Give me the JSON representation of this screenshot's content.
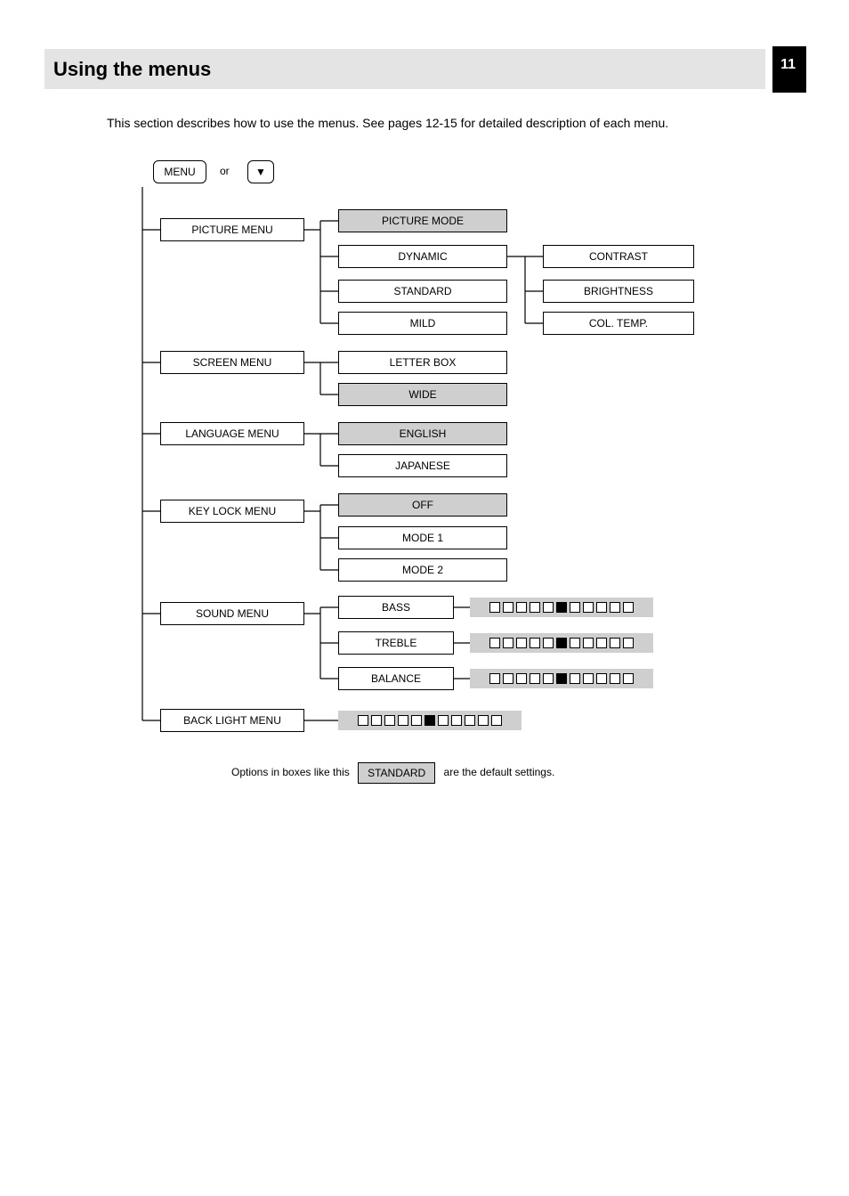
{
  "page_number": "11",
  "title": "Using the menus",
  "intro": "This section describes how to use the menus. See pages 12-15 for detailed description of each menu.",
  "root_button": "MENU",
  "arrow_button": "▼",
  "menu_items": {
    "picture": {
      "label": "PICTURE MENU",
      "options": {
        "picture_mode": "PICTURE MODE",
        "dynamic": "DYNAMIC",
        "standard": "STANDARD",
        "mild": "MILD",
        "contrast": "CONTRAST",
        "brightness": "BRIGHTNESS",
        "col_temp": "COL. TEMP."
      }
    },
    "screen": {
      "label": "SCREEN MENU",
      "options": {
        "letter_box": "LETTER BOX",
        "wide": "WIDE"
      }
    },
    "language": {
      "label": "LANGUAGE MENU",
      "options": {
        "english": "ENGLISH",
        "japanese": "JAPANESE"
      }
    },
    "key_lock": {
      "label": "KEY LOCK MENU",
      "options": {
        "off": "OFF",
        "mode1": "MODE 1",
        "mode2": "MODE 2"
      }
    },
    "sound": {
      "label": "SOUND MENU",
      "options": {
        "bass": "BASS",
        "treble": "TREBLE",
        "balance": "BALANCE"
      }
    },
    "back_light": {
      "label": "BACK LIGHT MENU"
    }
  },
  "footnote": {
    "pre": "Options in boxes like this",
    "box": "STANDARD",
    "post": "are the default settings."
  }
}
